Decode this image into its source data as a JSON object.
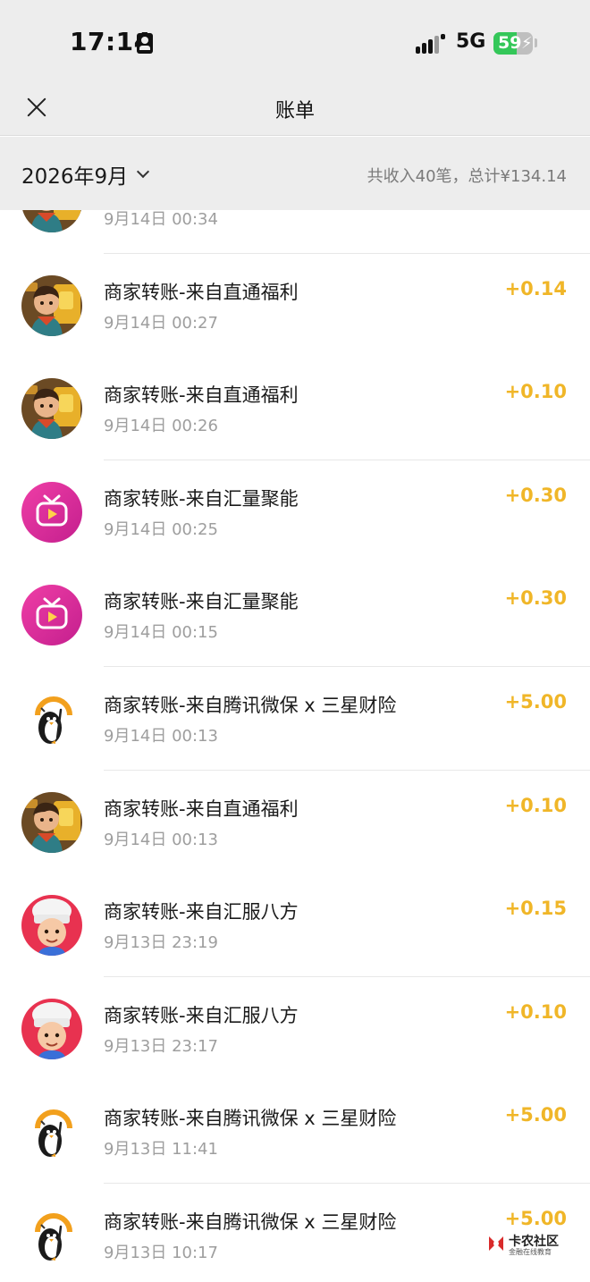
{
  "status_bar": {
    "time": "17:14",
    "network": "5G",
    "battery": "59",
    "battery_level": 0.59,
    "battery_color": "#34c759"
  },
  "header": {
    "title": "账单",
    "close_icon": "close-icon"
  },
  "filter": {
    "month": "2026年9月",
    "summary": "共收入40笔，总计¥134.14"
  },
  "colors": {
    "amount": "#f0b628",
    "secondary_text": "#9e9e9e",
    "header_bg": "#ededed"
  },
  "bills": [
    {
      "title": "",
      "time": "9月14日 00:34",
      "amount": "",
      "avatar": "game-hero-avatar"
    },
    {
      "title": "商家转账-来自直通福利",
      "time": "9月14日 00:27",
      "amount": "+0.14",
      "avatar": "game-hero-avatar"
    },
    {
      "title": "商家转账-来自直通福利",
      "time": "9月14日 00:26",
      "amount": "+0.10",
      "avatar": "game-hero-avatar"
    },
    {
      "title": "商家转账-来自汇量聚能",
      "time": "9月14日 00:25",
      "amount": "+0.30",
      "avatar": "tv-play-avatar"
    },
    {
      "title": "商家转账-来自汇量聚能",
      "time": "9月14日 00:15",
      "amount": "+0.30",
      "avatar": "tv-play-avatar"
    },
    {
      "title": "商家转账-来自腾讯微保 x 三星财险",
      "time": "9月14日 00:13",
      "amount": "+5.00",
      "avatar": "penguin-umbrella-avatar"
    },
    {
      "title": "商家转账-来自直通福利",
      "time": "9月14日 00:13",
      "amount": "+0.10",
      "avatar": "game-hero-avatar"
    },
    {
      "title": "商家转账-来自汇服八方",
      "time": "9月13日 23:19",
      "amount": "+0.15",
      "avatar": "chef-cartoon-avatar"
    },
    {
      "title": "商家转账-来自汇服八方",
      "time": "9月13日 23:17",
      "amount": "+0.10",
      "avatar": "chef-cartoon-avatar"
    },
    {
      "title": "商家转账-来自腾讯微保 x 三星财险",
      "time": "9月13日 11:41",
      "amount": "+5.00",
      "avatar": "penguin-umbrella-avatar"
    },
    {
      "title": "商家转账-来自腾讯微保 x 三星财险",
      "time": "9月13日 10:17",
      "amount": "+5.00",
      "avatar": "penguin-umbrella-avatar"
    }
  ],
  "watermark": {
    "name": "卡农社区",
    "sub": "金融在线教育"
  }
}
